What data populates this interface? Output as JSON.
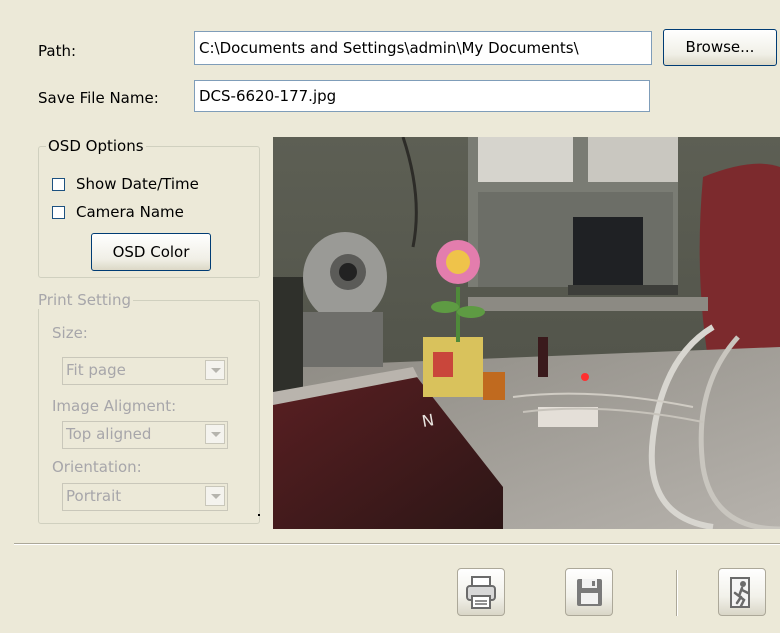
{
  "path": {
    "label": "Path:",
    "value": "C:\\Documents and Settings\\admin\\My Documents\\",
    "browse_label": "Browse..."
  },
  "save_file": {
    "label": "Save File Name:",
    "value": "DCS-6620-177.jpg"
  },
  "osd": {
    "title": "OSD Options",
    "show_datetime_label": "Show Date/Time",
    "show_datetime_checked": false,
    "camera_name_label": "Camera Name",
    "camera_name_checked": false,
    "color_button_label": "OSD Color"
  },
  "print_setting": {
    "title": "Print Setting",
    "size_label": "Size:",
    "size_value": "Fit page",
    "alignment_label": "Image Aligment:",
    "alignment_value": "Top aligned",
    "orientation_label": "Orientation:",
    "orientation_value": "Portrait"
  },
  "preview": {
    "book_label": "N"
  },
  "toolbar": {
    "print_icon": "printer-icon",
    "save_icon": "floppy-disk-icon",
    "exit_icon": "exit-door-icon"
  }
}
